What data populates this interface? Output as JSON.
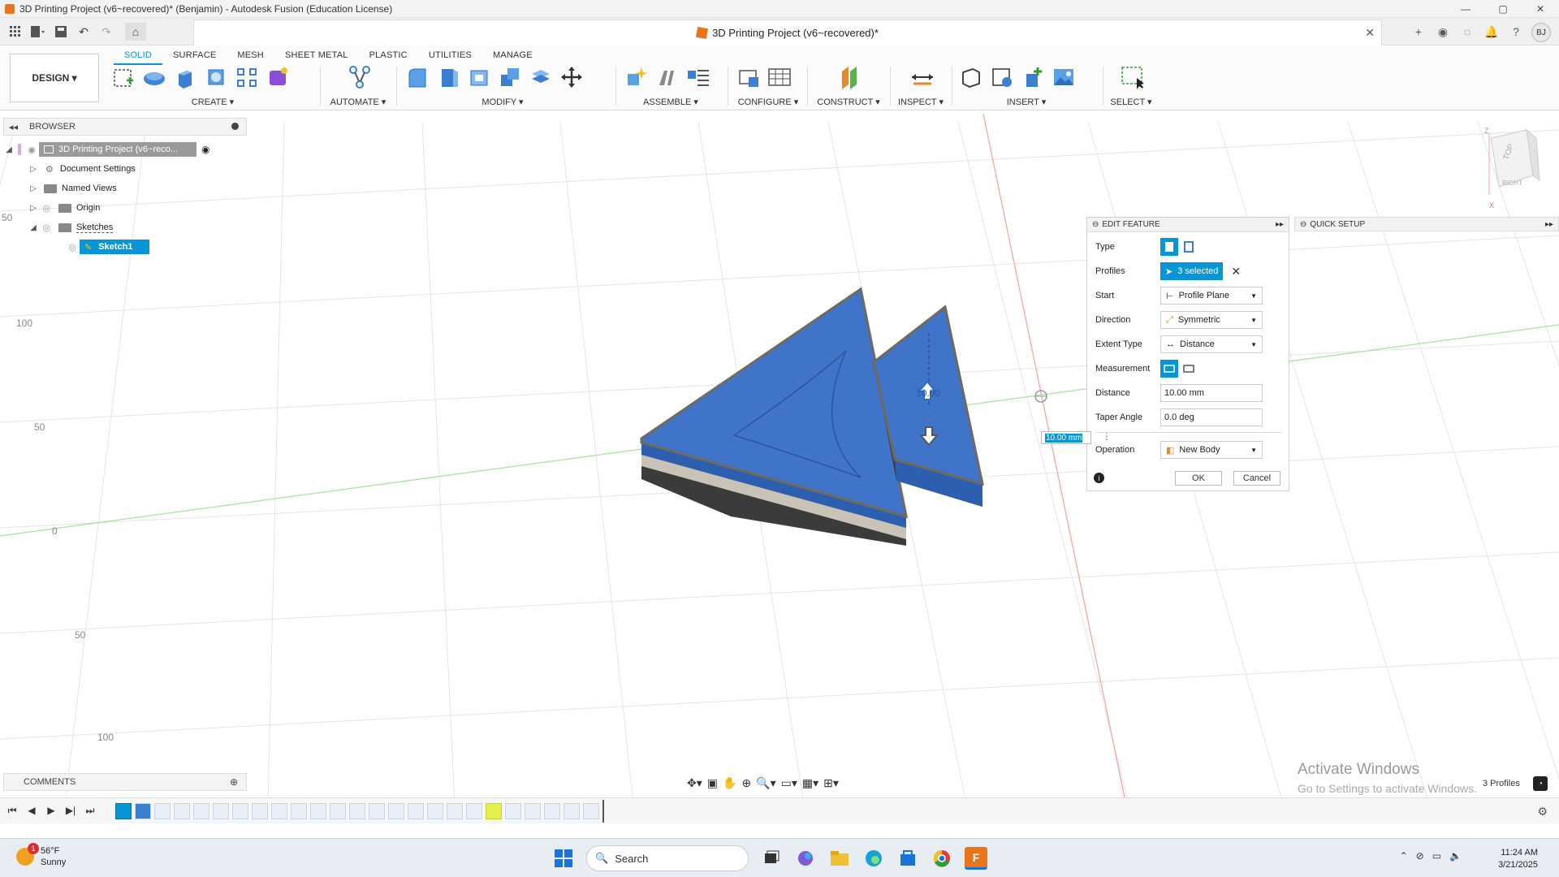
{
  "window": {
    "title": "3D Printing Project (v6~recovered)* (Benjamin) - Autodesk Fusion (Education License)",
    "controls": {
      "minimize": "—",
      "maximize": "▢",
      "close": "✕"
    }
  },
  "doc_tab": {
    "title": "3D Printing Project (v6~recovered)*",
    "close": "✕"
  },
  "user": {
    "initials": "BJ"
  },
  "ribbon": {
    "workspace": "DESIGN ▾",
    "tabs": [
      "SOLID",
      "SURFACE",
      "MESH",
      "SHEET METAL",
      "PLASTIC",
      "UTILITIES",
      "MANAGE"
    ],
    "groups": {
      "create": "CREATE ▾",
      "automate": "AUTOMATE ▾",
      "modify": "MODIFY ▾",
      "assemble": "ASSEMBLE ▾",
      "configure": "CONFIGURE ▾",
      "construct": "CONSTRUCT ▾",
      "inspect": "INSPECT ▾",
      "insert": "INSERT ▾",
      "select": "SELECT ▾"
    }
  },
  "browser": {
    "header": "BROWSER",
    "root": "3D Printing Project (v6~reco...",
    "items": [
      "Document Settings",
      "Named Views",
      "Origin",
      "Sketches"
    ],
    "sketch": "Sketch1"
  },
  "viewcube": {
    "top": "TOP",
    "right": "RIGHT"
  },
  "edit_feature": {
    "header": "EDIT FEATURE",
    "labels": {
      "type": "Type",
      "profiles": "Profiles",
      "start": "Start",
      "direction": "Direction",
      "extent": "Extent Type",
      "measurement": "Measurement",
      "distance": "Distance",
      "taper": "Taper Angle",
      "operation": "Operation"
    },
    "values": {
      "profiles": "3 selected",
      "start": "Profile Plane",
      "direction": "Symmetric",
      "extent": "Distance",
      "distance": "10.00 mm",
      "taper": "0.0 deg",
      "operation": "New Body"
    },
    "ok": "OK",
    "cancel": "Cancel"
  },
  "quick_setup": {
    "header": "QUICK SETUP"
  },
  "dimension_input": "10.00 mm",
  "drag_label": "10.00",
  "grid_labels": [
    "50",
    "100",
    "50",
    "0",
    "50",
    "100"
  ],
  "comments": {
    "header": "COMMENTS"
  },
  "status": {
    "profiles": "3 Profiles"
  },
  "watermark": {
    "line1": "Activate Windows",
    "line2": "Go to Settings to activate Windows."
  },
  "taskbar": {
    "weather_temp": "56°F",
    "weather_desc": "Sunny",
    "weather_badge": "1",
    "search": "Search",
    "time": "11:24 AM",
    "date": "3/21/2025"
  },
  "colors": {
    "accent": "#0696d7",
    "model_blue": "#3f74c8",
    "model_edge": "#4a4a4a",
    "accent_orange": "#e8751a"
  }
}
